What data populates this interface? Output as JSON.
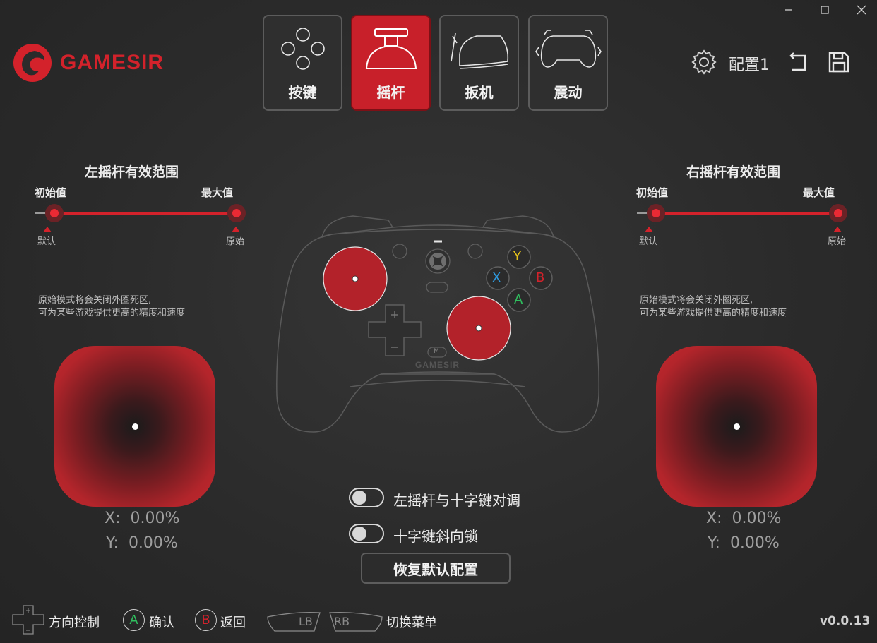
{
  "brand": {
    "logo_text": "GAMESIR",
    "accent": "#d3222b"
  },
  "window": {
    "minimize_icon": "minimize-icon",
    "maximize_icon": "maximize-icon",
    "close_icon": "close-icon"
  },
  "tabs": [
    {
      "label": "按键",
      "icon": "buttons-icon",
      "active": false
    },
    {
      "label": "摇杆",
      "icon": "joystick-icon",
      "active": true
    },
    {
      "label": "扳机",
      "icon": "trigger-icon",
      "active": false
    },
    {
      "label": "震动",
      "icon": "vibration-icon",
      "active": false
    }
  ],
  "toolbar": {
    "config_name": "配置1",
    "settings_icon": "gear-icon",
    "undo_icon": "undo-icon",
    "save_icon": "save-icon"
  },
  "left_stick": {
    "title": "左摇杆有效范围",
    "min_label": "初始值",
    "max_label": "最大值",
    "min_marker": "默认",
    "max_marker": "原始",
    "description_line1": "原始模式将会关闭外圈死区,",
    "description_line2": "可为某些游戏提供更高的精度和速度",
    "x_label": "X:",
    "x_value": "0.00%",
    "y_label": "Y:",
    "y_value": "0.00%"
  },
  "right_stick": {
    "title": "右摇杆有效范围",
    "min_label": "初始值",
    "max_label": "最大值",
    "min_marker": "默认",
    "max_marker": "原始",
    "description_line1": "原始模式将会关闭外圈死区,",
    "description_line2": "可为某些游戏提供更高的精度和速度",
    "x_label": "X:",
    "x_value": "0.00%",
    "y_label": "Y:",
    "y_value": "0.00%"
  },
  "controller": {
    "buttons": {
      "y": "Y",
      "x": "X",
      "b": "B",
      "a": "A",
      "m": "M"
    },
    "brand_text": "GAMESIR",
    "y_color": "#e6c31a",
    "x_color": "#2e9be0",
    "b_color": "#d3222b",
    "a_color": "#2fbf5e"
  },
  "options": {
    "swap_label": "左摇杆与十字键对调",
    "swap_on": false,
    "diagonal_label": "十字键斜向锁",
    "diagonal_on": false,
    "reset_label": "恢复默认配置"
  },
  "footer": {
    "dpad_label": "方向控制",
    "confirm_btn": "A",
    "confirm_label": "确认",
    "back_btn": "B",
    "back_label": "返回",
    "lb": "LB",
    "rb": "RB",
    "switch_label": "切换菜单",
    "version": "v0.0.13"
  }
}
